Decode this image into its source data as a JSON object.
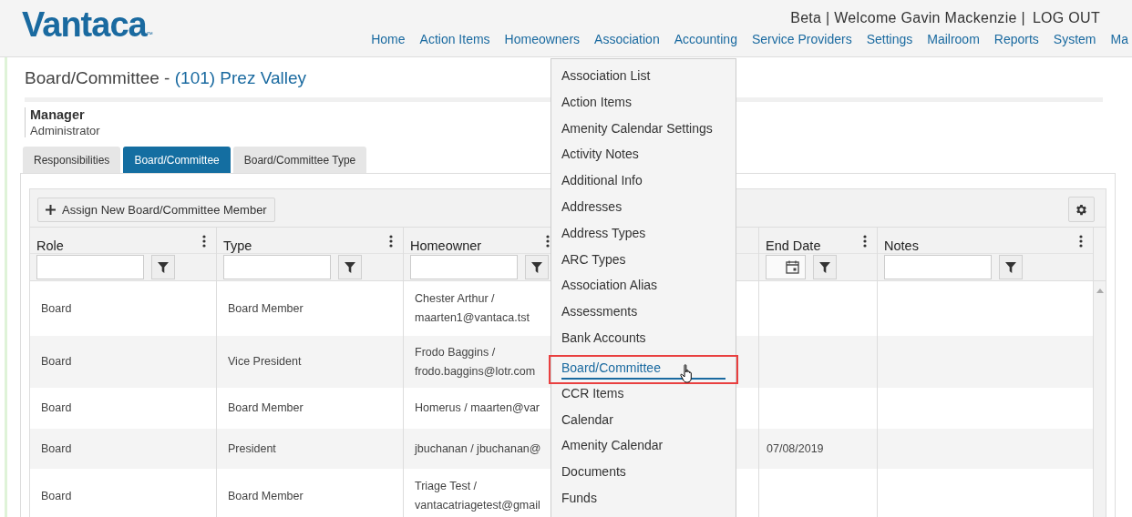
{
  "header": {
    "logo": "Vantaca",
    "trademark": "™",
    "user_text": "Beta | Welcome Gavin Mackenzie |",
    "logout": "LOG OUT",
    "nav": [
      "Home",
      "Action Items",
      "Homeowners",
      "Association",
      "Accounting",
      "Service Providers",
      "Settings",
      "Mailroom",
      "Reports",
      "System",
      "Ma"
    ]
  },
  "page": {
    "title": "Board/Committee - ",
    "association": "(101) Prez Valley",
    "manager_label": "Manager",
    "manager_value": "Administrator"
  },
  "tabs": [
    {
      "label": "Responsibilities",
      "selected": false
    },
    {
      "label": "Board/Committee",
      "selected": true
    },
    {
      "label": "Board/Committee Type",
      "selected": false
    }
  ],
  "toolbar": {
    "add_button": "Assign New Board/Committee Member"
  },
  "table": {
    "columns": [
      {
        "label": "Role",
        "kind": "text"
      },
      {
        "label": "Type",
        "kind": "text"
      },
      {
        "label": "Homeowner",
        "kind": "text"
      },
      {
        "kind": "none"
      },
      {
        "label": "End Date",
        "kind": "date"
      },
      {
        "label": "Notes",
        "kind": "text"
      }
    ],
    "rows": [
      {
        "role": "Board",
        "type": "Board Member",
        "homeowner": [
          "Chester Arthur /",
          "maarten1@vantaca.tst"
        ],
        "end_date": ""
      },
      {
        "role": "Board",
        "type": "Vice President",
        "homeowner": [
          "Frodo Baggins /",
          "frodo.baggins@lotr.com"
        ],
        "end_date": ""
      },
      {
        "role": "Board",
        "type": "Board Member",
        "homeowner": [
          "Homerus / maarten@var"
        ],
        "end_date": ""
      },
      {
        "role": "Board",
        "type": "President",
        "homeowner": [
          "jbuchanan / jbuchanan@"
        ],
        "end_date": "07/08/2019"
      },
      {
        "role": "Board",
        "type": "Board Member",
        "homeowner": [
          "Triage Test /",
          "vantacatriagetest@gmail"
        ],
        "end_date": ""
      }
    ]
  },
  "dropdown": {
    "items": [
      {
        "label": "Association List",
        "selected": false
      },
      {
        "label": "Action Items",
        "selected": false
      },
      {
        "label": "Amenity Calendar Settings",
        "selected": false
      },
      {
        "label": "Activity Notes",
        "selected": false
      },
      {
        "label": "Additional Info",
        "selected": false
      },
      {
        "label": "Addresses",
        "selected": false
      },
      {
        "label": "Address Types",
        "selected": false
      },
      {
        "label": "ARC Types",
        "selected": false
      },
      {
        "label": "Association Alias",
        "selected": false
      },
      {
        "label": "Assessments",
        "selected": false
      },
      {
        "label": "Bank Accounts",
        "selected": false
      },
      {
        "label": "Board/Committee",
        "selected": true
      },
      {
        "label": "CCR Items",
        "selected": false
      },
      {
        "label": "Calendar",
        "selected": false
      },
      {
        "label": "Amenity Calendar",
        "selected": false
      },
      {
        "label": "Documents",
        "selected": false
      },
      {
        "label": "Funds",
        "selected": false
      }
    ]
  }
}
